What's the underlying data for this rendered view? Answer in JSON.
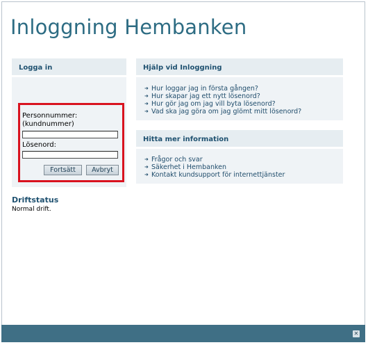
{
  "page": {
    "title": "Inloggning Hembanken"
  },
  "login": {
    "heading": "Logga in",
    "personnummer_label_line1": "Personnummer:",
    "personnummer_label_line2": "(kundnummer)",
    "personnummer_value": "",
    "password_label": "Lösenord:",
    "password_value": "",
    "continue_label": "Fortsätt",
    "cancel_label": "Avbryt"
  },
  "help": {
    "heading": "Hjälp vid Inloggning",
    "links": [
      "Hur loggar jag in första gången?",
      "Hur skapar jag ett nytt lösenord?",
      "Hur gör jag om jag vill byta lösenord?",
      "Vad ska jag göra om jag glömt mitt lösenord?"
    ]
  },
  "info": {
    "heading": "Hitta mer information",
    "links": [
      "Frågor och svar",
      "Säkerhet i Hembanken",
      "Kontakt kundsupport för internettjänster"
    ]
  },
  "status": {
    "heading": "Driftstatus",
    "text": "Normal drift."
  },
  "footer": {
    "close_glyph": "✕"
  }
}
